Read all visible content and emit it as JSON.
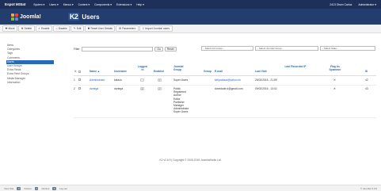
{
  "topbar": {
    "site_name": "Espot MSIat",
    "menu": [
      "System ▾",
      "Users ▾",
      "Menus ▾",
      "Content ▾",
      "Components ▾",
      "Extensions ▾",
      "Help ▾"
    ],
    "user": "2413 Olsen Carlos",
    "admin": "Administrator ▾"
  },
  "header": {
    "logo_text": "Joomla!",
    "k2_badge": "K2",
    "title": "Users"
  },
  "toolbar": [
    {
      "label": "Move",
      "icon": "✚"
    },
    {
      "label": "Delete",
      "icon": "✖"
    },
    {
      "label": "Enable",
      "icon": "✔"
    },
    {
      "label": "Disable",
      "icon": "⦸"
    },
    {
      "label": "Edit",
      "icon": "✎"
    },
    {
      "label": "Reset User Details",
      "icon": "✖"
    },
    {
      "label": "Parameters",
      "icon": "⚙"
    },
    {
      "label": "Import Joomla! users",
      "icon": "⇩"
    }
  ],
  "sidebar": [
    "Items",
    "Categories",
    "Tags",
    "Comments",
    "Users",
    "User Groups",
    "Extra Fields",
    "Extra Field Groups",
    "Media Manager",
    "Information"
  ],
  "sidebar_active": "Users",
  "filter": {
    "label": "Filter:",
    "value": "",
    "go_label": "Go",
    "reset_label": "Reset",
    "selects": [
      "- Select K2 Group -",
      "- Select Joomla! Group -",
      "- Select State -"
    ]
  },
  "table": {
    "headers": {
      "num": "#",
      "name": "Name ▲",
      "username": "Username",
      "logged": "Logged in",
      "enabled": "Enabled",
      "jgroup": "Joomla! Group",
      "group": "Group",
      "email": "E-mail",
      "lastvisit": "Last Visit",
      "lastip": "Last Recorded IP",
      "spammer": "Flag As Spammer",
      "id": "ID"
    },
    "rows": [
      {
        "num": "1",
        "name": "Administrator",
        "username": "kalaca",
        "logged": "",
        "enabled": "✔",
        "jgroup": "Super Users",
        "group": "",
        "email": "kellycalaca@yahoo.es",
        "lastvisit": "25/02/2015 - 21:59",
        "lastip": "",
        "spammer": "✕",
        "id": "42"
      },
      {
        "num": "2",
        "name": "dortega",
        "username": "dortega",
        "logged": "●",
        "enabled": "✔",
        "jgroup": "Public\nRegistered\nAuthor\nEditor\nPublisher\nManager\nAdministrator\nSuper Users",
        "group": "",
        "email": "dvoedade.d@gmail.com",
        "lastvisit": "09/02/2015 - 13:02",
        "lastip": "",
        "spammer": "✕",
        "id": "43"
      }
    ]
  },
  "footer": {
    "text": "K2 v2.6.9 | Copyright © 2006-2015 JoomlaWorks Ltd."
  },
  "statusbar": {
    "view_site": "View Site",
    "visitors": "0",
    "visitors_label": "Visitors",
    "admins": "1",
    "admins_label": "Admins",
    "messages": "0",
    "logout": "Log out",
    "version": "© Joomla! 3.3.6"
  }
}
